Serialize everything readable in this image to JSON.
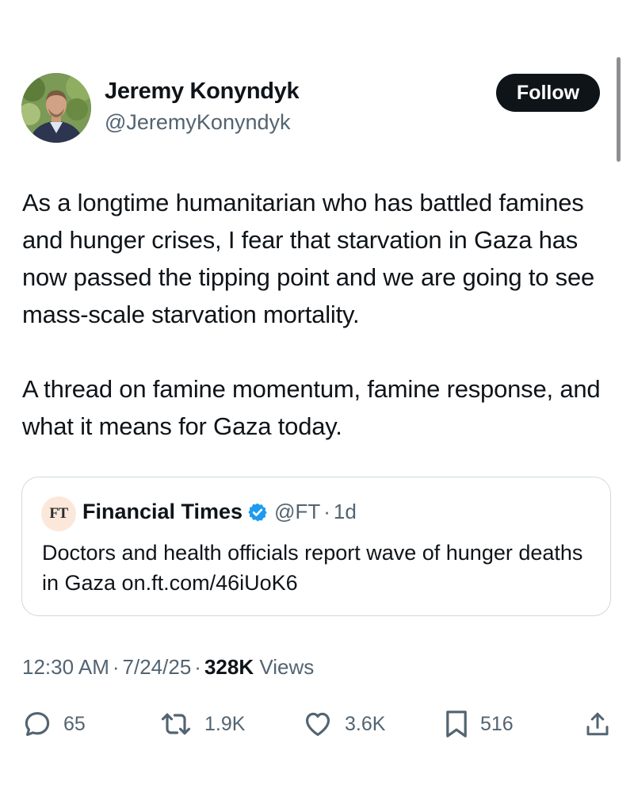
{
  "author": {
    "name": "Jeremy Konyndyk",
    "handle": "@JeremyKonyndyk"
  },
  "follow_label": "Follow",
  "tweet": {
    "paragraph1": "As a longtime humanitarian who has battled famines and hunger crises, I fear that starvation in Gaza has now passed the tipping point and we are going to see mass-scale starvation mortality.",
    "paragraph2": "A thread on famine momentum, famine response, and what it means for Gaza today."
  },
  "quote": {
    "logo_text": "FT",
    "name": "Financial Times",
    "handle": "@FT",
    "separator": "·",
    "time": "1d",
    "text": "Doctors and health officials report wave of hunger deaths in Gaza on.ft.com/46iUoK6"
  },
  "meta": {
    "time": "12:30 AM",
    "separator": "·",
    "date": "7/24/25",
    "views_count": "328K",
    "views_label": "Views"
  },
  "actions": {
    "replies": "65",
    "reposts": "1.9K",
    "likes": "3.6K",
    "bookmarks": "516"
  },
  "icons": {
    "reply": "reply-icon",
    "repost": "repost-icon",
    "like": "heart-icon",
    "bookmark": "bookmark-icon",
    "share": "share-icon",
    "verified": "verified-badge-icon"
  },
  "colors": {
    "text": "#0f1419",
    "secondary": "#536471",
    "verified": "#1d9bf0",
    "border": "#cfd9de",
    "follow_bg": "#0f1419"
  }
}
